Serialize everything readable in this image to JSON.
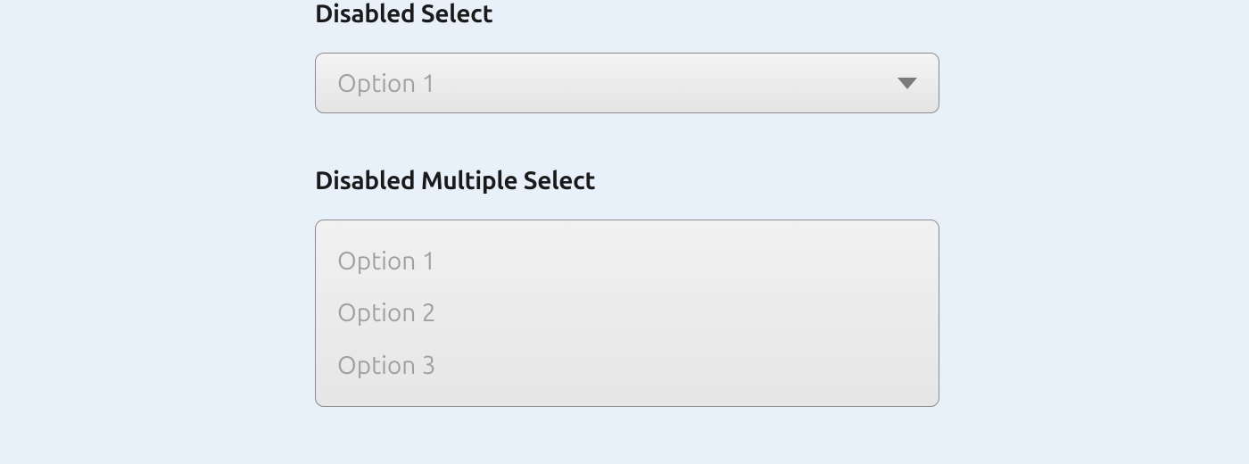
{
  "single": {
    "label": "Disabled Select",
    "value": "Option 1"
  },
  "multi": {
    "label": "Disabled Multiple Select",
    "options": [
      "Option 1",
      "Option 2",
      "Option 3"
    ]
  }
}
